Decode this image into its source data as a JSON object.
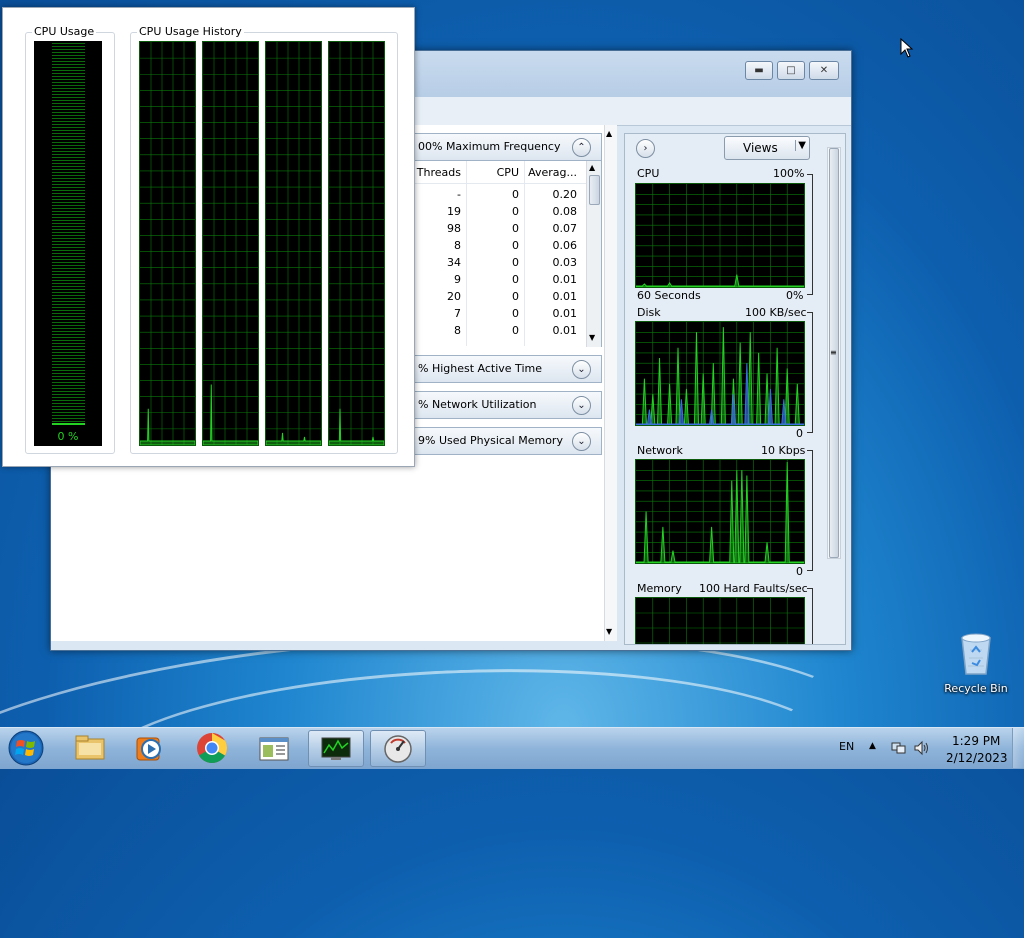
{
  "cpu_meter": {
    "usage_title": "CPU Usage",
    "usage_value": "0 %",
    "history_title": "CPU Usage History"
  },
  "resource_monitor": {
    "cpu_section": {
      "title": "00% Maximum Frequency",
      "columns": [
        "Threads",
        "CPU",
        "Averag..."
      ],
      "rows": [
        [
          "-",
          "0",
          "0.20"
        ],
        [
          "19",
          "0",
          "0.08"
        ],
        [
          "98",
          "0",
          "0.07"
        ],
        [
          "8",
          "0",
          "0.06"
        ],
        [
          "34",
          "0",
          "0.03"
        ],
        [
          "9",
          "0",
          "0.01"
        ],
        [
          "20",
          "0",
          "0.01"
        ],
        [
          "7",
          "0",
          "0.01"
        ],
        [
          "8",
          "0",
          "0.01"
        ]
      ]
    },
    "sections": [
      {
        "title": "% Highest Active Time"
      },
      {
        "title": "% Network Utilization"
      },
      {
        "title": "9% Used Physical Memory"
      }
    ],
    "views_button": "Views",
    "graphs": {
      "cpu": {
        "label": "CPU",
        "max": "100%",
        "time": "60 Seconds",
        "min": "0%"
      },
      "disk": {
        "label": "Disk",
        "max": "100 KB/sec",
        "min": "0"
      },
      "network": {
        "label": "Network",
        "max": "10 Kbps",
        "min": "0"
      },
      "memory": {
        "label": "Memory",
        "max": "100 Hard Faults/sec"
      }
    }
  },
  "desktop": {
    "recycle_bin": "Recycle Bin"
  },
  "taskbar": {
    "language": "EN",
    "time": "1:29 PM",
    "date": "2/12/2023"
  },
  "colors": {
    "graph_green": "#23d223",
    "graph_grid": "#0b7a0b",
    "disk_blue": "#3a6fe0"
  }
}
